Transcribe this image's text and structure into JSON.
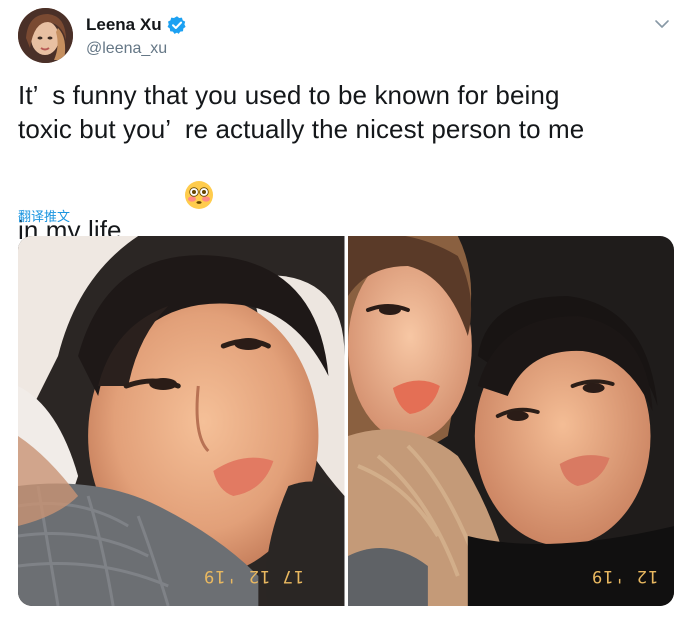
{
  "user": {
    "display_name": "Leena Xu",
    "handle": "@leena_xu",
    "verified": true,
    "avatar": "profile-photo"
  },
  "tweet": {
    "lines": [
      "It’  s funny that you used to be known for being",
      "toxic but you’  re actually the nicest person to me",
      "in my life"
    ],
    "emoji": "flushed-face-emoji",
    "translate_label": "翻译推文"
  },
  "media": {
    "photos": [
      {
        "stamp": "17 12 '19"
      },
      {
        "stamp": "12 '19"
      }
    ]
  },
  "colors": {
    "text": "#14171a",
    "secondary": "#657786",
    "link": "#1b95e0",
    "verified": "#1da1f2",
    "date_stamp": "#e9b860"
  }
}
